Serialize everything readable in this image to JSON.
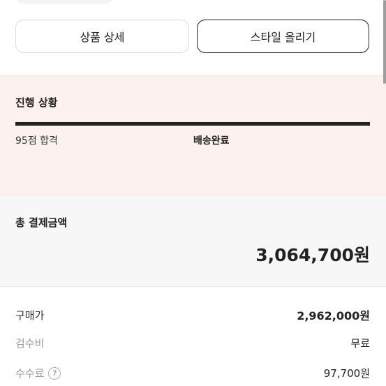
{
  "buttons": {
    "product_detail": "상품 상세",
    "upload_style": "스타일 올리기"
  },
  "progress": {
    "title": "진행 상황",
    "steps": [
      "95점 합격",
      "배송완료"
    ]
  },
  "total": {
    "label": "총 결제금액",
    "amount": "3,064,700원"
  },
  "breakdown": [
    {
      "label": "구매가",
      "value": "2,962,000원"
    },
    {
      "label": "검수비",
      "value": "무료"
    },
    {
      "label": "수수료",
      "value": "97,700원"
    }
  ]
}
